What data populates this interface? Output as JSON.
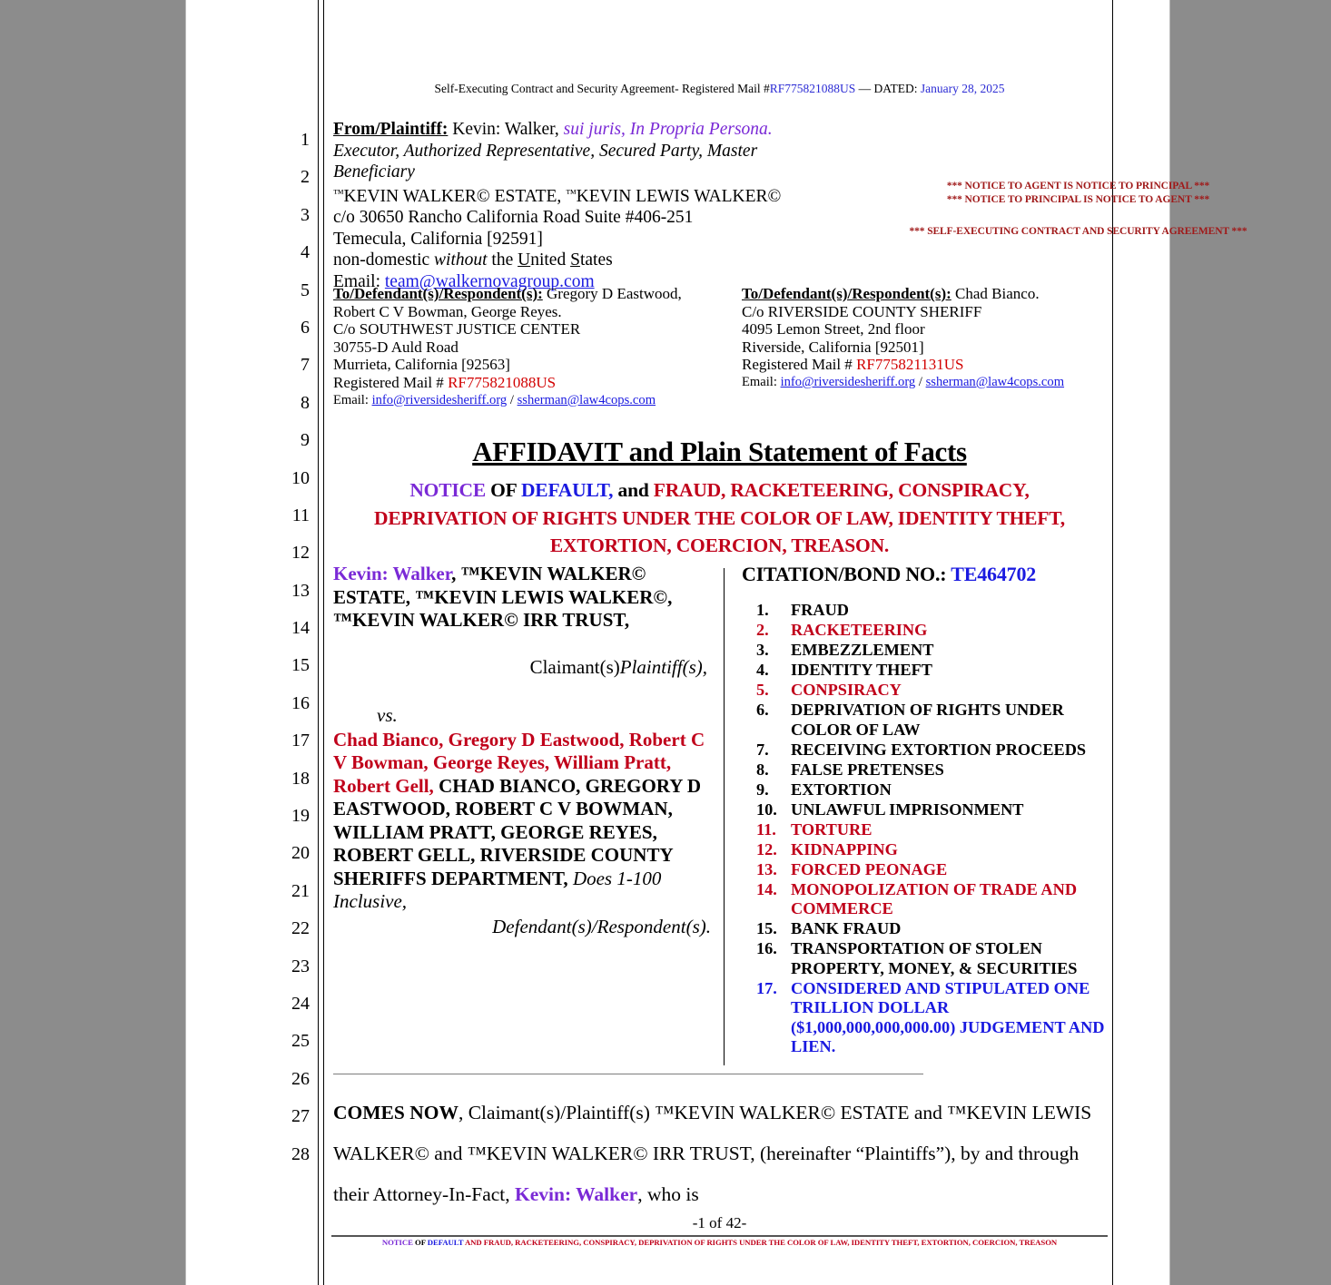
{
  "header": {
    "prefix": "Self-Executing Contract and Security Agreement- Registered Mail #",
    "mail_number": "RF775821088US",
    "dated_label": " — DATED: ",
    "date": "January 28, 2025"
  },
  "from_block": {
    "label": "From/Plaintiff:",
    "name": " Kevin: Walker, ",
    "status": "sui juris, In Propria Persona.",
    "roles": "Executor, Authorized Representative, Secured Party, Master Beneficiary",
    "entities_line": "KEVIN WALKER© ESTATE, ",
    "entities_line2": "KEVIN LEWIS WALKER©",
    "address1": "c/o  30650 Rancho California Road Suite #406-251",
    "address2": "Temecula, California [92591]",
    "nondomestic_pre": "non-domestic ",
    "nondomestic_ital": "without",
    "nondomestic_post": " the ",
    "nondomestic_u1": "U",
    "nondomestic_mid": "nited ",
    "nondomestic_u2": "S",
    "nondomestic_end": "tates",
    "email_label": "Email: ",
    "email": "team@walkernovagroup.com"
  },
  "notice_block": {
    "line1": "*** NOTICE TO AGENT IS NOTICE TO PRINCIPAL ***",
    "line2": "*** NOTICE TO PRINCIPAL IS NOTICE TO AGENT ***",
    "line3": "*** SELF-EXECUTING CONTRACT AND SECURITY AGREEMENT ***"
  },
  "addr_left": {
    "label": "To/Defendant(s)/Respondent(s):",
    "names": "  Gregory D Eastwood, Robert C V Bowman, George Reyes.",
    "line1": "C/o SOUTHWEST JUSTICE CENTER",
    "line2": "30755-D Auld Road",
    "line3": "Murrieta, California [92563]",
    "mail_label": "Registered Mail # ",
    "mail_number": "RF775821088US",
    "email_label": "Email: ",
    "email1": "info@riversidesheriff.org",
    "email_sep": " / ",
    "email2": "ssherman@law4cops.com"
  },
  "addr_right": {
    "label": "To/Defendant(s)/Respondent(s):",
    "names": " Chad Bianco.",
    "line1": "C/o RIVERSIDE COUNTY SHERIFF",
    "line2": "4095 Lemon Street, 2nd floor",
    "line3": "Riverside, California [92501]",
    "mail_label": "Registered Mail # ",
    "mail_number": "RF775821131US",
    "email_label": "Email: ",
    "email1": "info@riversidesheriff.org",
    "email_sep": " / ",
    "email2": "ssherman@law4cops.com"
  },
  "title": {
    "main": "AFFIDAVIT and Plain Statement of Facts",
    "sub_notice": "NOTICE",
    "sub_of": " OF ",
    "sub_default": "DEFAULT,",
    "sub_and": " and ",
    "sub_rest": "FRAUD, RACKETEERING, CONSPIRACY, DEPRIVATION OF RIGHTS UNDER THE COLOR OF LAW, IDENTITY THEFT, EXTORTION, COERCION, TREASON."
  },
  "caption": {
    "plaintiff_name": "Kevin: Walker",
    "plaintiff_entities": ", ™KEVIN WALKER© ESTATE, ™KEVIN LEWIS WALKER©, ™KEVIN WALKER© IRR TRUST,",
    "claimant_plain": "Claimant(s)",
    "claimant_ital": "Plaintiff(s),",
    "vs": "vs.",
    "defendants_red": "Chad Bianco, Gregory D Eastwood, Robert C V Bowman, George Reyes, William Pratt, Robert Gell,",
    "defendants_black": " CHAD BIANCO, GREGORY D EASTWOOD, ROBERT C V BOWMAN, WILLIAM PRATT, GEORGE REYES, ROBERT GELL, RIVERSIDE COUNTY SHERIFFS DEPARTMENT,",
    "does_ital": " Does 1-100 Inclusive,",
    "respondent_line": "Defendant(s)/Respondent(s).",
    "citation_label": "CITATION/BOND NO.: ",
    "citation_number": "TE464702",
    "charges": [
      {
        "n": "1.",
        "text": "FRAUD",
        "color": "black"
      },
      {
        "n": "2.",
        "text": "RACKETEERING",
        "color": "red"
      },
      {
        "n": "3.",
        "text": "EMBEZZLEMENT",
        "color": "black"
      },
      {
        "n": "4.",
        "text": "IDENTITY THEFT",
        "color": "black"
      },
      {
        "n": "5.",
        "text": "CONPSIRACY",
        "color": "red"
      },
      {
        "n": "6.",
        "text": "DEPRIVATION OF RIGHTS UNDER COLOR OF LAW",
        "color": "black"
      },
      {
        "n": "7.",
        "text": "RECEIVING EXTORTION PROCEEDS",
        "color": "black"
      },
      {
        "n": "8.",
        "text": "FALSE PRETENSES",
        "color": "black"
      },
      {
        "n": "9.",
        "text": "EXTORTION",
        "color": "black"
      },
      {
        "n": "10.",
        "text": "UNLAWFUL IMPRISONMENT",
        "color": "black"
      },
      {
        "n": "11.",
        "text": "TORTURE",
        "color": "red"
      },
      {
        "n": "12.",
        "text": "KIDNAPPING",
        "color": "red"
      },
      {
        "n": "13.",
        "text": "FORCED PEONAGE",
        "color": "red"
      },
      {
        "n": "14.",
        "text": "MONOPOLIZATION OF TRADE AND COMMERCE",
        "color": "red"
      },
      {
        "n": "15.",
        "text": "BANK FRAUD",
        "color": "black"
      },
      {
        "n": "16.",
        "text": "TRANSPORTATION OF STOLEN PROPERTY, MONEY, & SECURITIES",
        "color": "black"
      },
      {
        "n": "17.",
        "text": "CONSIDERED AND STIPULATED ONE TRILLION DOLLAR ($1,000,000,000,000.00) JUDGEMENT AND LIEN.",
        "color": "blue"
      }
    ]
  },
  "body": {
    "comes_now": "COMES NOW",
    "text1": ", Claimant(s)/Plaintiff(s) ™KEVIN WALKER© ESTATE and ™KEVIN LEWIS WALKER© and ™KEVIN WALKER© IRR TRUST, (hereinafter “Plaintiffs”), by and through their Attorney-In-Fact, ",
    "attorney": "Kevin: Walker",
    "text2": ", who is"
  },
  "footer": {
    "page_number": "-1 of 42-",
    "notice": "NOTICE",
    "of": " OF ",
    "default": "DEFAULT",
    "rest": " AND FRAUD, RACKETEERING, CONSPIRACY, DEPRIVATION OF RIGHTS UNDER THE COLOR OF LAW, IDENTITY THEFT, EXTORTION, COERCION, TREASON"
  },
  "line_numbers": [
    "1",
    "2",
    "3",
    "4",
    "5",
    "6",
    "7",
    "8",
    "9",
    "10",
    "11",
    "12",
    "13",
    "14",
    "15",
    "16",
    "17",
    "18",
    "19",
    "20",
    "21",
    "22",
    "23",
    "24",
    "25",
    "26",
    "27",
    "28"
  ],
  "colors": {
    "red": "#c0001a",
    "blue": "#1a1ae0",
    "purple": "#7a29d6",
    "notice_red": "#a01a1a",
    "page_bg": "#8c8c8c"
  }
}
